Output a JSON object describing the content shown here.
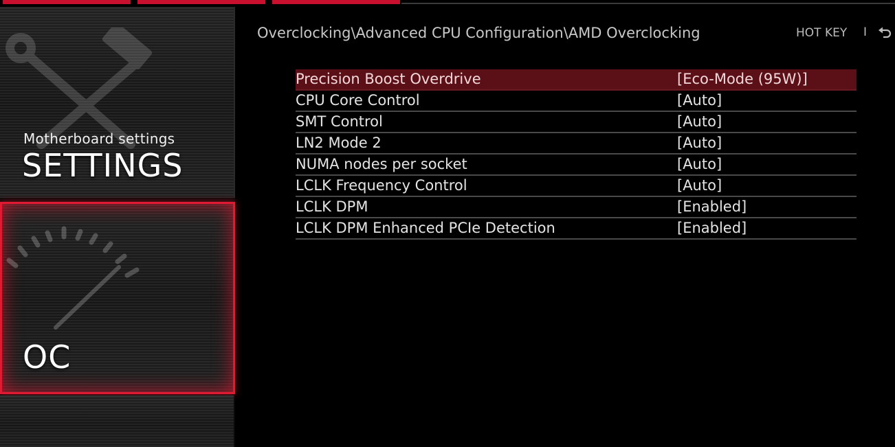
{
  "sidebar": {
    "settings": {
      "subtitle": "Motherboard settings",
      "title": "SETTINGS",
      "icon": "wrench-hammer-icon"
    },
    "oc": {
      "title": "OC",
      "icon": "speedometer-gauge-icon",
      "active": true
    }
  },
  "header": {
    "breadcrumb": "Overclocking\\Advanced CPU Configuration\\AMD Overclocking",
    "hotkey_label": "HOT KEY",
    "separator": "I",
    "back_icon": "back-arrow-icon"
  },
  "settings": [
    {
      "label": "Precision Boost Overdrive",
      "value": "[Eco-Mode (95W)]",
      "selected": true
    },
    {
      "label": "CPU Core Control",
      "value": "[Auto]"
    },
    {
      "label": "SMT Control",
      "value": "[Auto]"
    },
    {
      "label": "LN2 Mode 2",
      "value": "[Auto]"
    },
    {
      "label": "NUMA nodes per socket",
      "value": "[Auto]"
    },
    {
      "label": "LCLK Frequency Control",
      "value": "[Auto]"
    },
    {
      "label": "LCLK DPM",
      "value": "[Enabled]"
    },
    {
      "label": "LCLK DPM Enhanced PCIe Detection",
      "value": "[Enabled]"
    }
  ],
  "colors": {
    "accent": "#e01a33",
    "selected_row": "#5a1016",
    "background": "#000000"
  }
}
